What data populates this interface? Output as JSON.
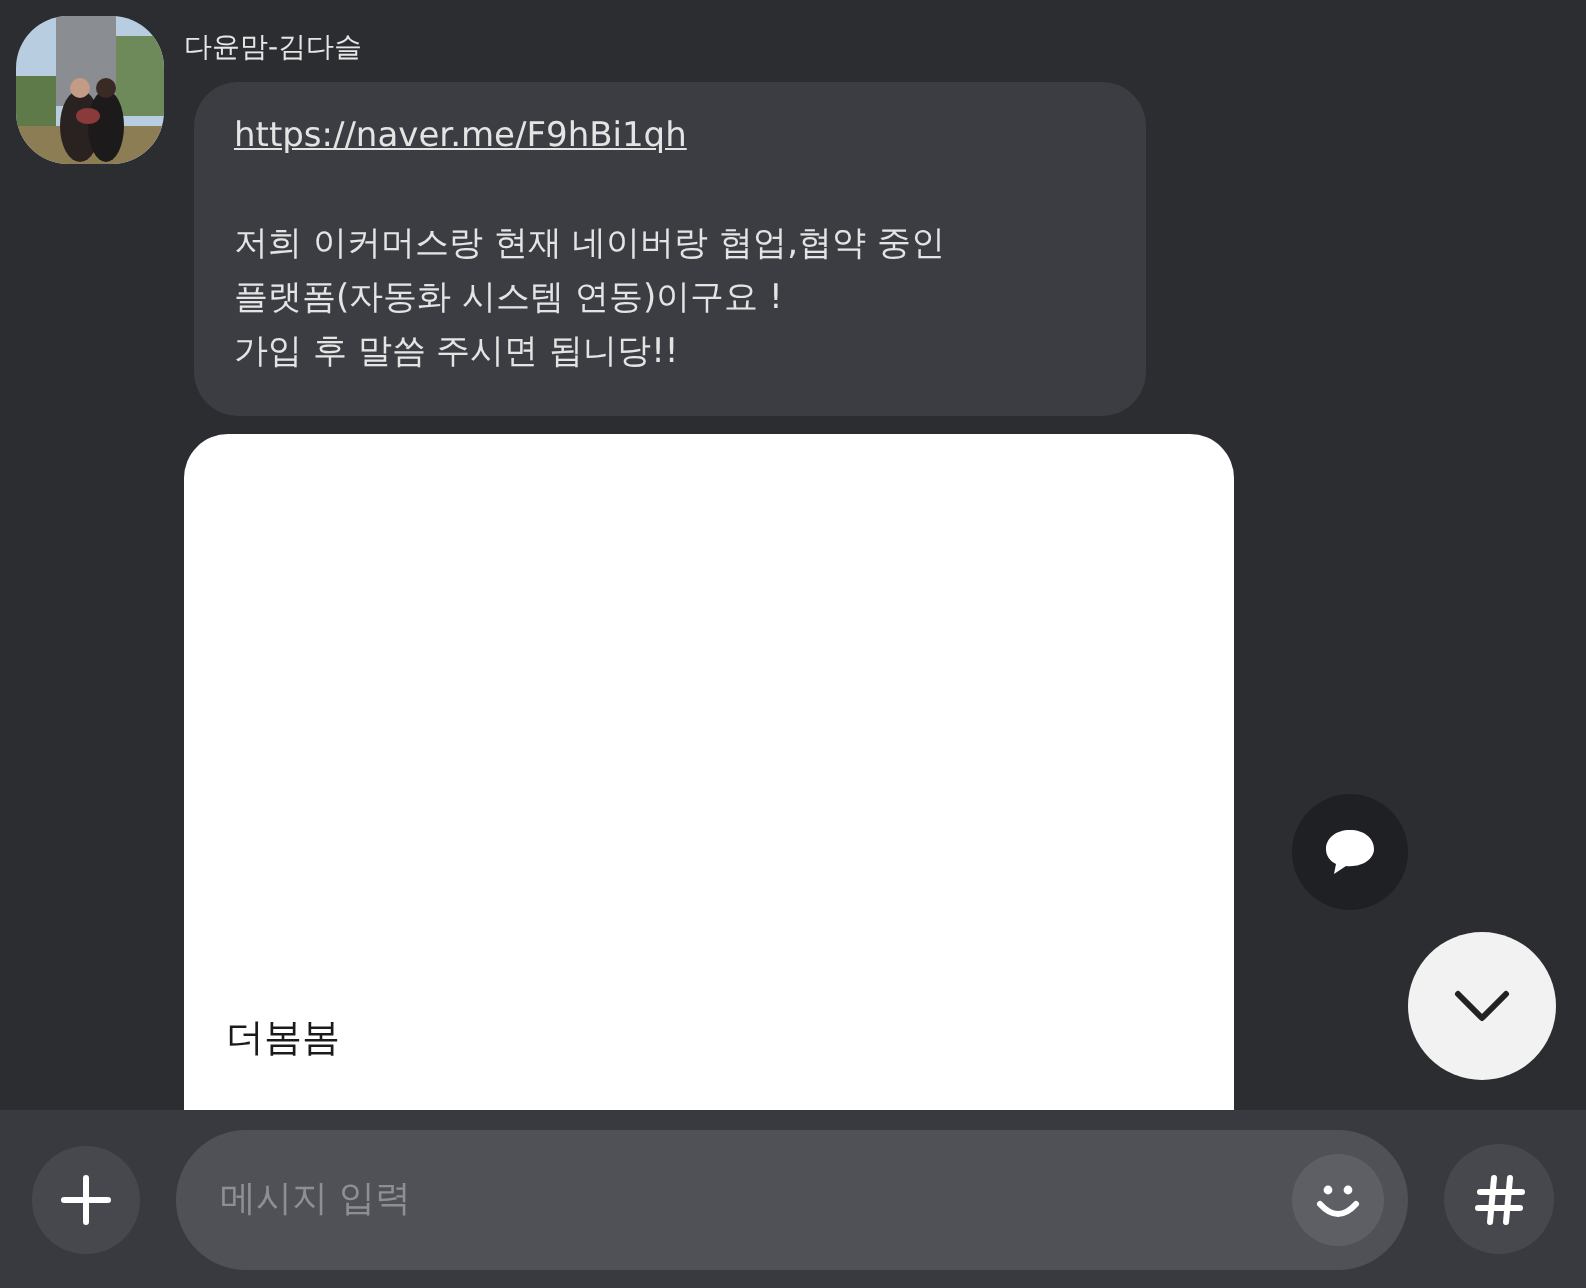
{
  "message": {
    "sender": "다윤맘-김다슬",
    "link": "https://naver.me/F9hBi1qh",
    "lines": [
      "저희 이커머스랑 현재 네이버랑 협업,협약 중인",
      "플랫폼(자동화 시스템 연동)이구요 !",
      "가입 후 말씀 주시면 됩니당!!"
    ]
  },
  "preview_card": {
    "title": "더봄봄"
  },
  "composer": {
    "placeholder": "메시지 입력"
  }
}
